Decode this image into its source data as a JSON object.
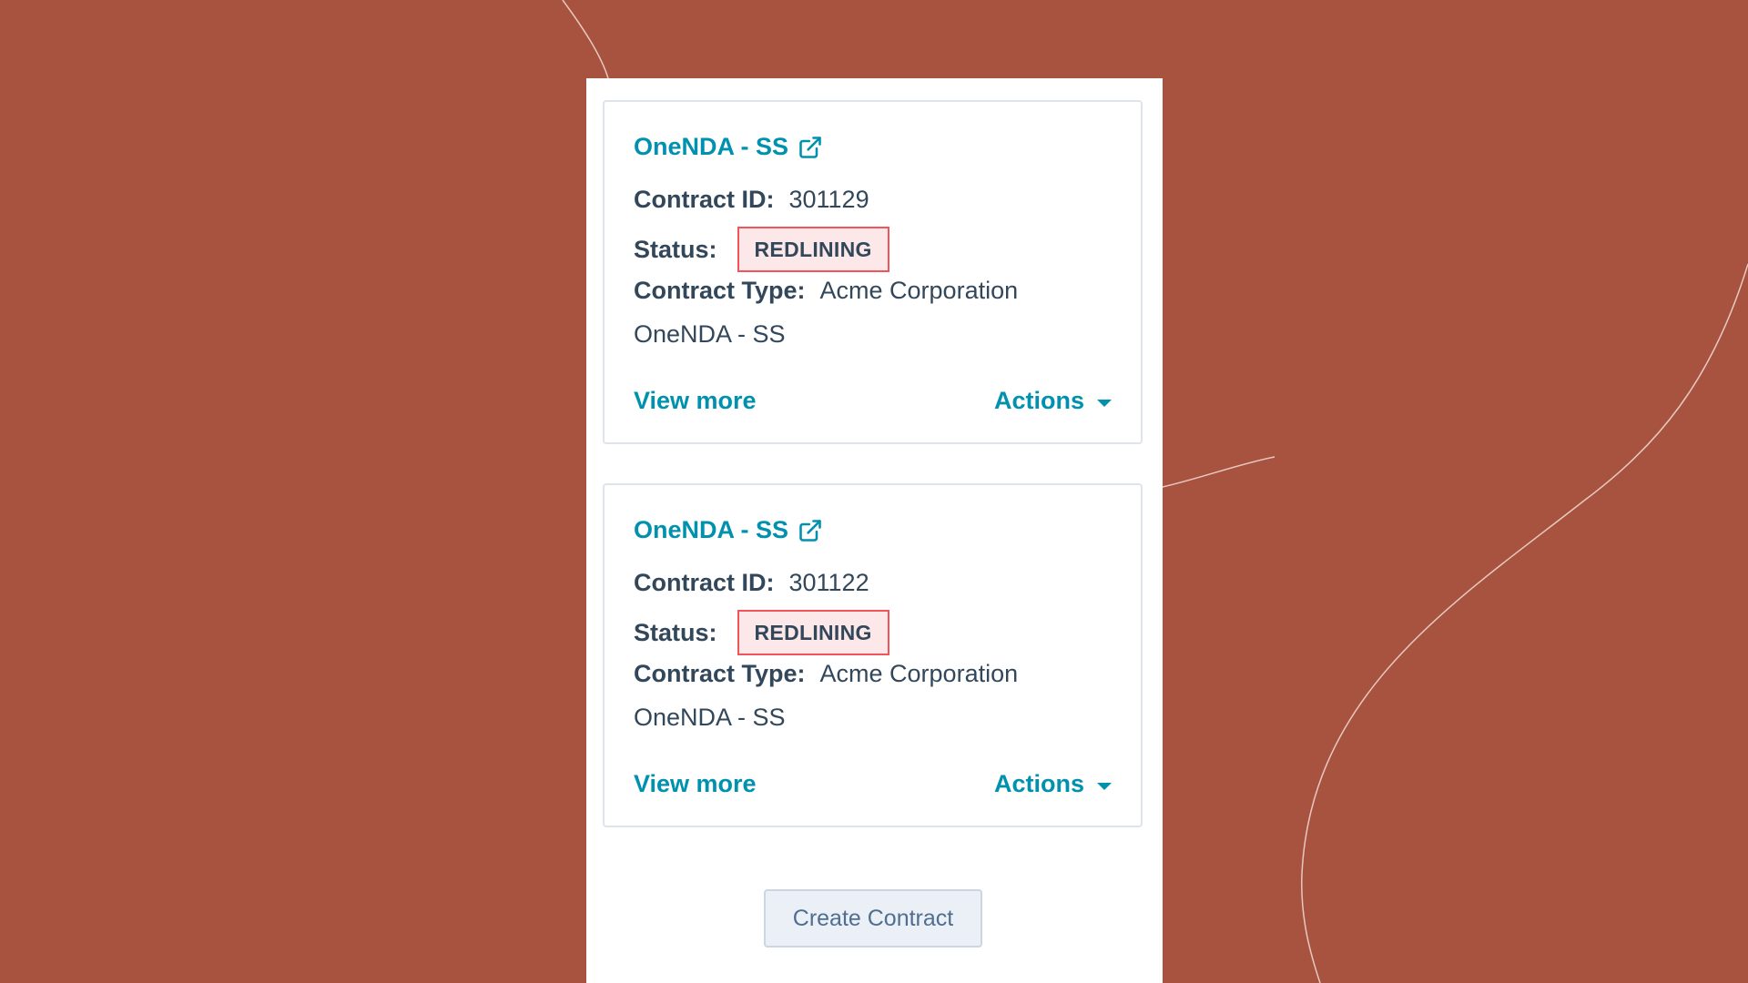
{
  "colors": {
    "background": "#a85340",
    "panel": "#ffffff",
    "link": "#0091ae",
    "text": "#33475b",
    "badge_border": "#f2545b",
    "badge_fill": "#fde8e9",
    "button_fill": "#eaf0f6",
    "button_text": "#506e91"
  },
  "contracts": [
    {
      "title": "OneNDA - SS",
      "title_icon": "external-link-icon",
      "id_label": "Contract ID:",
      "id_value": "301129",
      "status_label": "Status:",
      "status_value": "REDLINING",
      "type_label": "Contract Type:",
      "type_value_line1": "Acme Corporation",
      "type_value_line2": "OneNDA - SS",
      "view_more_label": "View more",
      "actions_label": "Actions",
      "actions_icon": "caret-down-icon"
    },
    {
      "title": "OneNDA - SS",
      "title_icon": "external-link-icon",
      "id_label": "Contract ID:",
      "id_value": "301122",
      "status_label": "Status:",
      "status_value": "REDLINING",
      "type_label": "Contract Type:",
      "type_value_line1": "Acme Corporation",
      "type_value_line2": "OneNDA - SS",
      "view_more_label": "View more",
      "actions_label": "Actions",
      "actions_icon": "caret-down-icon"
    }
  ],
  "create_button_label": "Create Contract"
}
